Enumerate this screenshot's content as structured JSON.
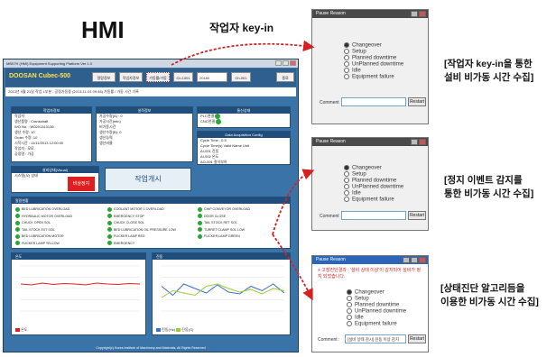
{
  "hmi_label": "HMI",
  "key_in_label": "작업자 key-in",
  "hmi_window": {
    "title": "MB07H (HMI) Equipment Supporting Platform Ver 1.0",
    "logo": "DOOSAN Cubec-500",
    "toolbar": {
      "btn1": "알람정보",
      "btn2": "작업자정보",
      "btn3": "가동률/가동",
      "btn4": "Ch.1001",
      "box1": "20180",
      "btn5": "Ch.001",
      "btn6": "종료"
    },
    "info_line": "2013년 9월 21일 작업 1부분 - 공정가동중 (2013-11-01 09:46) 가동률 / 가동 시간 기록",
    "work_panel": {
      "header": "작업자정보",
      "rows": [
        "작업자",
        "생산품명 : Crankshaft",
        "WO No. : W0201313136",
        "생산 수량: 10",
        "Order 수량: 10",
        "시작시간 : 11/11/2013 12:00:00",
        "작업자 : 모모",
        "공정명 : 가공"
      ]
    },
    "achieve_panel": {
      "header": "실적정보",
      "rows": [
        "가공수량(A) : 0",
        "가공시간(min)",
        "비가동시간",
        "생산수량(B): 0",
        "생산능력",
        "생산비율"
      ]
    },
    "comm_panel": {
      "header": "통신상태",
      "rows": [
        "PLC연결",
        "CNC연결"
      ]
    },
    "status_panel": {
      "header": "설비상태(Visual)",
      "row": "시스템(오) 상태",
      "badge": "비상정지"
    },
    "daq_panel": {
      "header": "Data Acquisition Config",
      "rows": [
        "Cycle Time : 0.5",
        "Cycle Time(s) Valid Name Unit",
        "AI-001 진동",
        "AI-002 온도",
        "AO-001 절삭부하"
      ]
    },
    "work_button": "작업개시",
    "alarm_panel": {
      "header": "알람현황",
      "items": [
        "BED LUBRICATION OVERLOAD",
        "HYDRAULIC MOTOR OVERLOAD",
        "CHUCK OPEN SOL",
        "TAIL STOCK EXT SOL",
        "BED LUBRICATION MOTOR",
        "FLICKER LAMP YELLOW",
        "COOLANT MOTOR 1 OVERLOAD",
        "EMERGENCY STOP",
        "CHUCK CLOSE SOL",
        "BED LUBRICATION OIL PRESSURE LOW",
        "FLICKER LAMP RED",
        "EMERGENCY",
        "CHIP CONVEYOR OVERLOAD",
        "DOOR CLOSE",
        "TAIL STOCK RET SOL",
        "TURRET CLAMP SOL LOW",
        "FLICKER LAMP GREEN"
      ]
    },
    "chart_left": {
      "header": "온도",
      "legend": "온도"
    },
    "chart_right": {
      "header": "진동",
      "legend1": "진동(Hz)",
      "legend2": "진동(G)"
    },
    "footer": "Copyright(c) Korea Institute of Machinery and Materials, All Rights Reserved"
  },
  "dialogs": [
    {
      "title": "Pause Reason",
      "options": [
        "Changeover",
        "Setup",
        "Planned downtime",
        "UnPlanned downtime",
        "Idle",
        "Equipment failure"
      ],
      "selected": 0,
      "comment_label": "Comment",
      "comment_value": "",
      "restart": "Restart"
    },
    {
      "title": "Pause Reason",
      "options": [
        "Changeover",
        "Setup",
        "Planned downtime",
        "UnPlanned downtime",
        "Idle",
        "Equipment failure"
      ],
      "selected": 0,
      "comment_label": "Comment",
      "comment_value": "",
      "restart": "Restart"
    },
    {
      "title": "Pause Reason",
      "alert": "+ 고장진단결과 : '설비 상태 이상'이 감지되어 설비가 정지 되었습니다.",
      "options": [
        "Changeover",
        "Setup",
        "Planned downtime",
        "UnPlanned downtime",
        "Idle",
        "Equipment failure"
      ],
      "selected": 0,
      "comment_label": "Comment :",
      "comment_value": "[설비 상태 감시] 진동 이상 감지",
      "restart": "Restart"
    }
  ],
  "captions": [
    [
      "[작업자 key-in을 통한",
      "설비 비가동 시간 수집]"
    ],
    [
      "[정지 이벤트 감지를",
      "통한 비가동 시간 수집]"
    ],
    [
      "[상태진단 알고리듬을",
      "이용한 비가동 시간 수집]"
    ]
  ],
  "colors": {
    "arrow": "#d42020",
    "window_blue": "#3a73a8",
    "panel_header": "#1f4e7d",
    "status_green": "#26a832",
    "alarm_red": "#e02020"
  },
  "chart_data": [
    {
      "type": "line",
      "title": "온도",
      "series": [
        {
          "name": "온도",
          "values": [
            60,
            58,
            62,
            59,
            61,
            60,
            58,
            62,
            60,
            59,
            61,
            60
          ]
        }
      ]
    },
    {
      "type": "line",
      "title": "진동",
      "series": [
        {
          "name": "진동(Hz)",
          "values": [
            55,
            35,
            60,
            50,
            40,
            58,
            42,
            38,
            55,
            45,
            60,
            40
          ]
        },
        {
          "name": "진동(G)",
          "values": [
            30,
            45,
            40,
            35,
            55,
            60,
            50,
            42,
            48,
            38,
            50,
            45
          ]
        }
      ]
    }
  ]
}
